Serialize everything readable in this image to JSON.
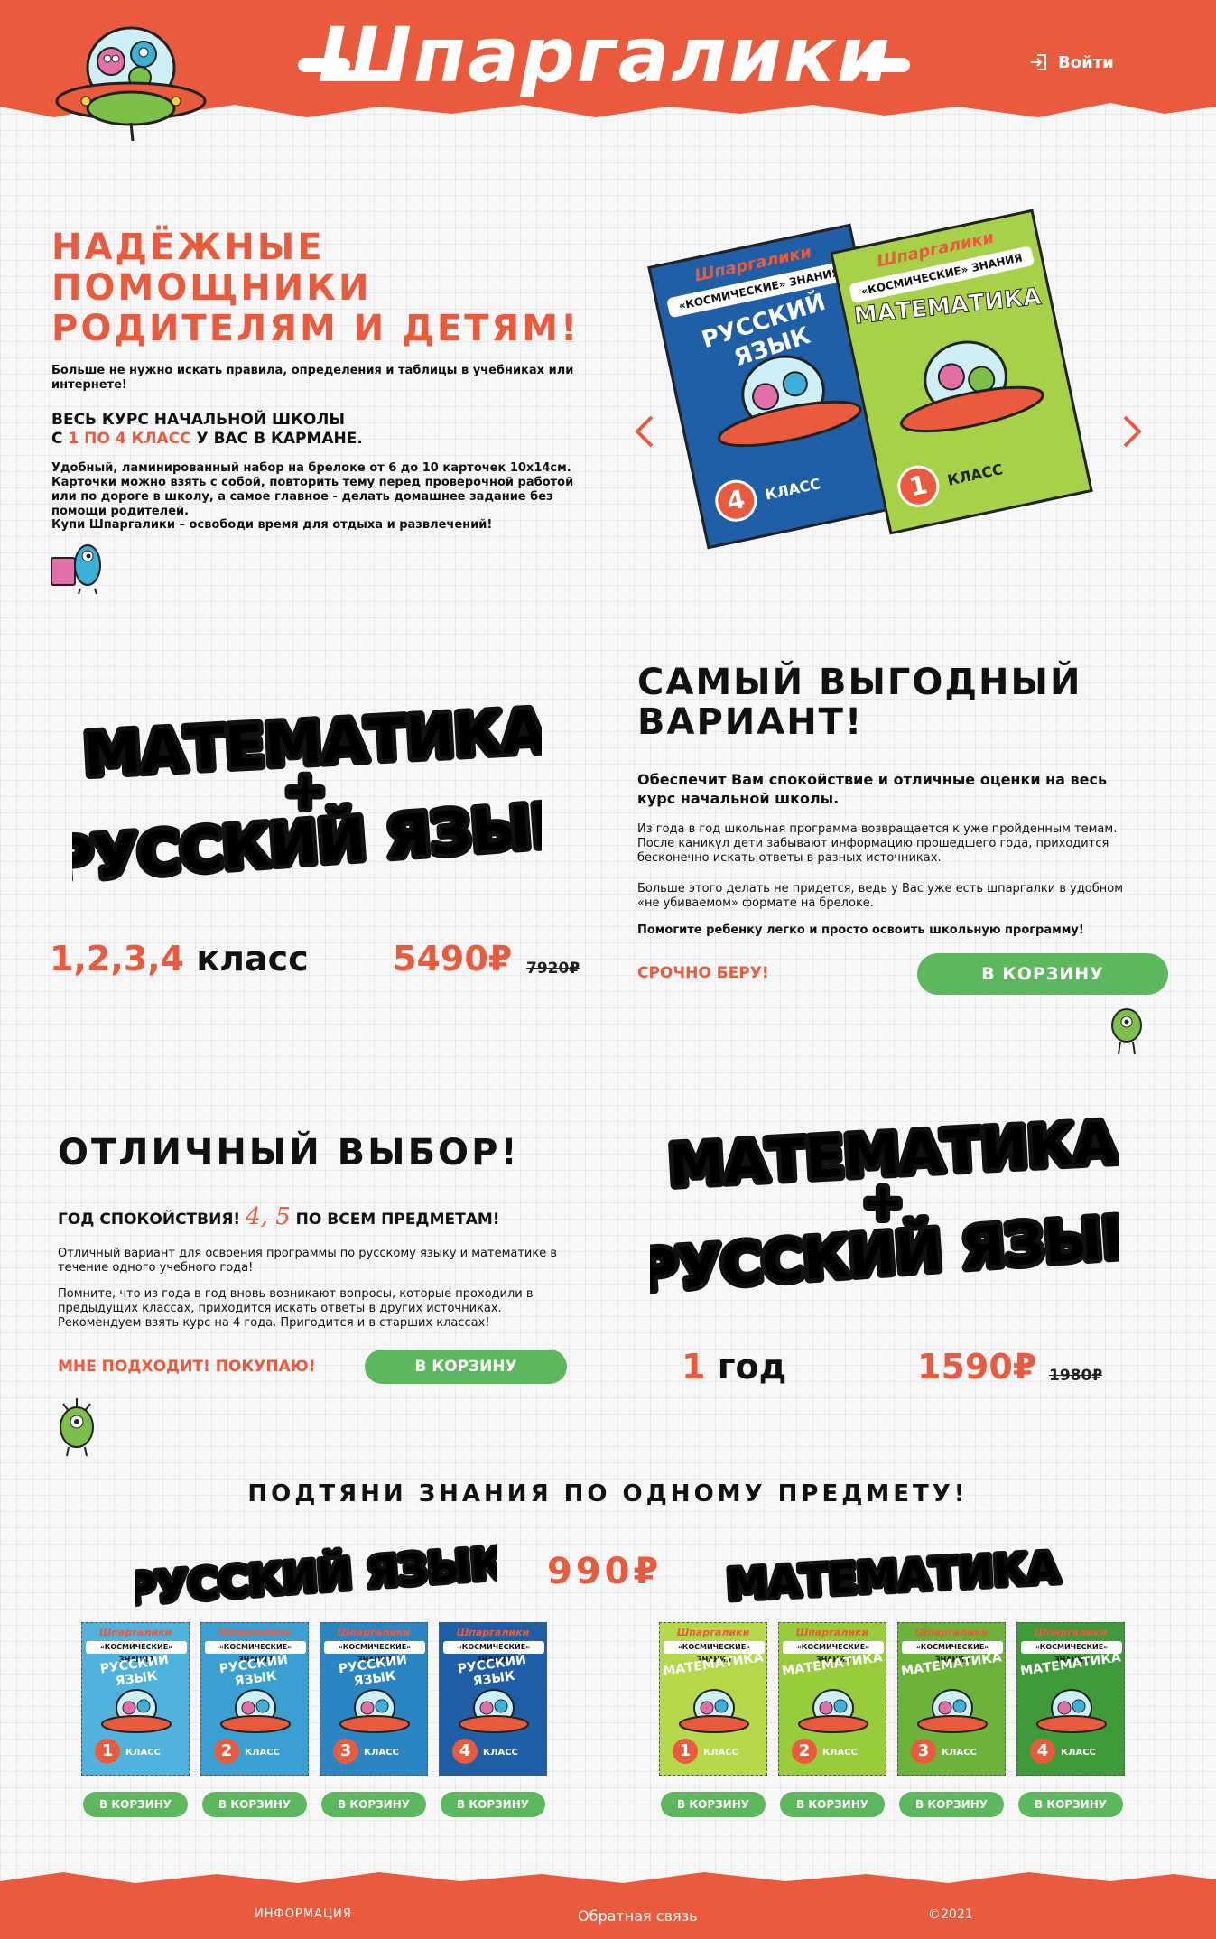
{
  "header": {
    "logo": "Шпаргалики",
    "login_label": "Войти",
    "brand_color": "#e95b3c",
    "accent_green": "#5cb85c"
  },
  "hero": {
    "title_lines": [
      "НАДЁЖНЫЕ",
      "ПОМОЩНИКИ",
      "РОДИТЕЛЯМ И ДЕТЯМ!"
    ],
    "intro": "Больше не нужно искать правила, определения и таблицы в учебниках или интернете!",
    "course_line1": "ВЕСЬ КУРС НАЧАЛЬНОЙ ШКОЛЫ",
    "course_pre": "С ",
    "course_highlight": "1 ПО 4 КЛАСС",
    "course_post": " У ВАС В КАРМАНЕ.",
    "description": "Удобный, ламинированный набор на брелоке от 6 до 10 карточек 10х14см. Карточки можно взять с собой, повторить тему перед проверочной работой или по дороге в школу, а самое главное - делать домашнее задание без помощи родителей.",
    "cta_text": "Купи Шпаргалики – освободи время для отдыха и развлечений!",
    "carousel_prev_icon": "chevron-left-icon",
    "carousel_next_icon": "chevron-right-icon",
    "book_russian": {
      "brand": "Шпаргалики",
      "series": "«КОСМИЧЕСКИЕ» ЗНАНИЯ",
      "subject": "РУССКИЙ ЯЗЫК",
      "grade": "4",
      "grade_word": "КЛАСС"
    },
    "book_math": {
      "brand": "Шпаргалики",
      "series": "«КОСМИЧЕСКИЕ» ЗНАНИЯ",
      "subject": "МАТЕМАТИКА",
      "grade": "1",
      "grade_word": "КЛАСС"
    }
  },
  "offer1": {
    "product_line1": "МАТЕМАТИКА",
    "plus": "+",
    "product_line2": "РУССКИЙ ЯЗЫК",
    "grades": "1,2,3,4",
    "grades_word": "класс",
    "price": "5490₽",
    "old_price": "7920₽",
    "heading_line1": "САМЫЙ ВЫГОДНЫЙ",
    "heading_line2": "ВАРИАНТ!",
    "lead": "Обеспечит Вам спокойствие и отличные оценки на весь курс начальной школы.",
    "para1": "Из года в год школьная программа возвращается к уже пройденным темам. После каникул дети забывают информацию прошедшего года, приходится бесконечно искать ответы в разных источниках.",
    "para2": "Больше этого делать не придется, ведь у Вас уже есть шпаргалки в удобном «не убиваемом» формате на брелоке.",
    "para3": "Помогите ребенку легко и просто освоить школьную программу!",
    "urgent": "СРОЧНО БЕРУ!",
    "button": "В КОРЗИНУ"
  },
  "offer2": {
    "heading": "ОТЛИЧНЫЙ ВЫБОР!",
    "lead_pre": "ГОД СПОКОЙСТВИЯ!",
    "lead_grades": "4, 5",
    "lead_post": "ПО ВСЕМ ПРЕДМЕТАМ!",
    "para1": "Отличный вариант для освоения программы по русскому языку и математике в течение одного учебного года!",
    "para2": "Помните, что из года в год вновь возникают вопросы, которые проходили в предыдущих классах, приходится искать ответы в других источниках. Рекомендуем взять курс на 4 года. Пригодится и в старших классах!",
    "cta": "МНЕ ПОДХОДИТ! ПОКУПАЮ!",
    "button": "В КОРЗИНУ",
    "product_line1": "МАТЕМАТИКА",
    "plus": "+",
    "product_line2": "РУССКИЙ ЯЗЫК",
    "years": "1",
    "years_word": "год",
    "price": "1590₽",
    "old_price": "1980₽"
  },
  "single": {
    "heading": "ПОДТЯНИ ЗНАНИЯ ПО ОДНОМУ ПРЕДМЕТУ!",
    "russian_title": "РУССКИЙ ЯЗЫК",
    "price": "990₽",
    "math_title": "МАТЕМАТИКА",
    "russian_cards": [
      {
        "brand": "Шпаргалики",
        "series": "«КОСМИЧЕСКИЕ» ЗНАНИЯ",
        "subject": "РУССКИЙ ЯЗЫК",
        "grade": "1",
        "grade_word": "КЛАСС",
        "button": "В КОРЗИНУ",
        "color": "#4fb3dd"
      },
      {
        "brand": "Шпаргалики",
        "series": "«КОСМИЧЕСКИЕ» ЗНАНИЯ",
        "subject": "РУССКИЙ ЯЗЫК",
        "grade": "2",
        "grade_word": "КЛАСС",
        "button": "В КОРЗИНУ",
        "color": "#3aa0d4"
      },
      {
        "brand": "Шпаргалики",
        "series": "«КОСМИЧЕСКИЕ» ЗНАНИЯ",
        "subject": "РУССКИЙ ЯЗЫК",
        "grade": "3",
        "grade_word": "КЛАСС",
        "button": "В КОРЗИНУ",
        "color": "#2a85c2"
      },
      {
        "brand": "Шпаргалики",
        "series": "«КОСМИЧЕСКИЕ» ЗНАНИЯ",
        "subject": "РУССКИЙ ЯЗЫК",
        "grade": "4",
        "grade_word": "КЛАСС",
        "button": "В КОРЗИНУ",
        "color": "#1f5fa8"
      }
    ],
    "math_cards": [
      {
        "brand": "Шпаргалики",
        "series": "«КОСМИЧЕСКИЕ» ЗНАНИЯ",
        "subject": "МАТЕМАТИКА",
        "grade": "1",
        "grade_word": "КЛАСС",
        "button": "В КОРЗИНУ",
        "color": "#b4d94a"
      },
      {
        "brand": "Шпаргалики",
        "series": "«КОСМИЧЕСКИЕ» ЗНАНИЯ",
        "subject": "МАТЕМАТИКА",
        "grade": "2",
        "grade_word": "КЛАСС",
        "button": "В КОРЗИНУ",
        "color": "#99cc3a"
      },
      {
        "brand": "Шпаргалики",
        "series": "«КОСМИЧЕСКИЕ» ЗНАНИЯ",
        "subject": "МАТЕМАТИКА",
        "grade": "3",
        "grade_word": "КЛАСС",
        "button": "В КОРЗИНУ",
        "color": "#6cb33a"
      },
      {
        "brand": "Шпаргалики",
        "series": "«КОСМИЧЕСКИЕ» ЗНАНИЯ",
        "subject": "МАТЕМАТИКА",
        "grade": "4",
        "grade_word": "КЛАСС",
        "button": "В КОРЗИНУ",
        "color": "#3f9a3a"
      }
    ]
  },
  "footer": {
    "info": "ИНФОРМАЦИЯ",
    "feedback": "Обратная связь",
    "copyright": "©2021"
  }
}
